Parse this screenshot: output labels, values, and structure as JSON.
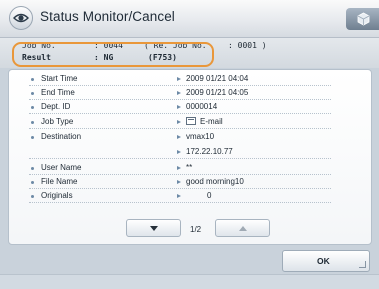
{
  "title": "Status Monitor/Cancel",
  "header": {
    "job_no_label": "Job No.",
    "job_no_value": ": 0044",
    "rel_job_label": "( Re. Job No.",
    "rel_job_value": ": 0001 )",
    "result_label": "Result",
    "result_value": ": NG",
    "result_code": "(F753)"
  },
  "details": [
    {
      "label": "Start Time",
      "value": "2009 01/21 04:04"
    },
    {
      "label": "End Time",
      "value": "2009 01/21 04:05"
    },
    {
      "label": "Dept. ID",
      "value": "0000014"
    },
    {
      "label": "Job Type",
      "value": "E-mail",
      "icon": "mail-icon"
    },
    {
      "label": "Destination",
      "value": "vmax10"
    },
    {
      "label": "",
      "value": "172.22.10.77"
    },
    {
      "label": "User Name",
      "value": "**"
    },
    {
      "label": "File Name",
      "value": "good morning10"
    },
    {
      "label": "Originals",
      "value": "0"
    }
  ],
  "pager": {
    "current": "1/2"
  },
  "ok_label": "OK",
  "colors": {
    "highlight": "#e9973a",
    "accent": "#6d8aa6"
  }
}
